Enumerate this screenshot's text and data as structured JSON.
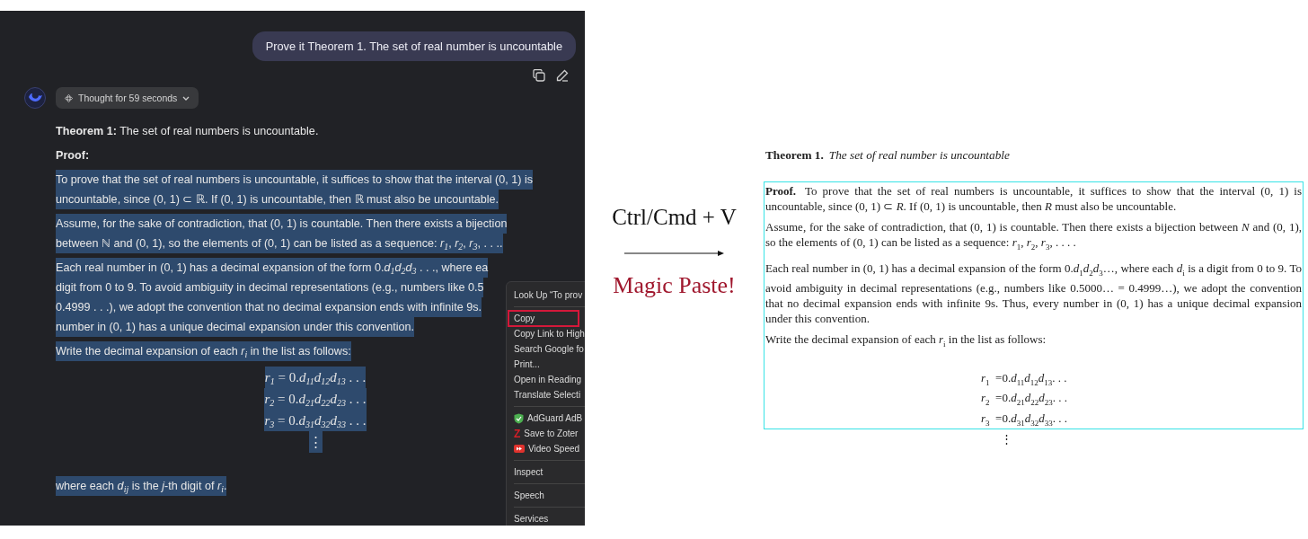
{
  "chat": {
    "user_message": "Prove it Theorem 1. The set of real number is uncountable",
    "thought_button": "Thought for 59 seconds",
    "answer": [
      {
        "kind": "paragraph",
        "selected": false,
        "lines": [
          "**Theorem 1:** The set of real numbers is uncountable."
        ]
      },
      {
        "kind": "heading",
        "selected": false,
        "lines": [
          "Proof:"
        ]
      },
      {
        "kind": "paragraph",
        "selected": true,
        "lines": [
          "To prove that the set of real numbers is uncountable, it suffices to show that the interval (0, 1) is",
          "uncountable, since (0, 1) ⊂ ℝ. If (0, 1) is uncountable, then ℝ must also be uncountable."
        ]
      },
      {
        "kind": "paragraph",
        "selected": true,
        "lines": [
          "Assume, for the sake of contradiction, that (0, 1) is countable. Then there exists a bijection",
          "between ℕ and (0, 1), so the elements of (0, 1) can be listed as a sequence: *r*$_{1}$, *r*$_{2}$, *r*$_{3}$, . . .."
        ]
      },
      {
        "kind": "paragraph",
        "selected": true,
        "lines": [
          "Each real number in (0, 1) has a decimal expansion of the form 0.*d*$_{1}$*d*$_{2}$*d*$_{3}$ . . ., where ea",
          "digit from 0 to 9. To avoid ambiguity in decimal representations (e.g., numbers like 0.5",
          "0.4999 . . .), we adopt the convention that no decimal expansion ends with infinite 9s.",
          "number in (0, 1) has a unique decimal expansion under this convention."
        ]
      },
      {
        "kind": "paragraph",
        "selected": true,
        "lines": [
          "Write the decimal expansion of each *r*$_{i}$ in the list as follows:"
        ]
      },
      {
        "kind": "equations",
        "selected": true,
        "lines": [
          "*r*$_{1}$ = 0.*d*$_{11}$*d*$_{12}$*d*$_{13}$ . . .",
          "*r*$_{2}$ = 0.*d*$_{21}$*d*$_{22}$*d*$_{23}$ . . .",
          "*r*$_{3}$ = 0.*d*$_{31}$*d*$_{32}$*d*$_{33}$ . . .",
          "⋮"
        ]
      },
      {
        "kind": "paragraph",
        "selected": true,
        "lines": [
          "where each *d*$_{ij}$ is the *j*-th digit of *r*$_{i}$."
        ]
      }
    ],
    "context_menu": [
      {
        "kind": "item",
        "label": "Look Up “To prov",
        "selected": false
      },
      {
        "kind": "separator"
      },
      {
        "kind": "item",
        "label": "Copy",
        "selected": true
      },
      {
        "kind": "item",
        "label": "Copy Link to High",
        "selected": false
      },
      {
        "kind": "item",
        "label": "Search Google fo",
        "selected": false
      },
      {
        "kind": "item",
        "label": "Print...",
        "selected": false
      },
      {
        "kind": "item",
        "label": "Open in Reading",
        "selected": false
      },
      {
        "kind": "item",
        "label": "Translate Selecti",
        "selected": false
      },
      {
        "kind": "separator"
      },
      {
        "kind": "shield",
        "label": "AdGuard AdB",
        "selected": false
      },
      {
        "kind": "letter",
        "icon": "Z",
        "label": "Save to Zoter",
        "selected": false
      },
      {
        "kind": "video",
        "label": "Video Speed",
        "selected": false
      },
      {
        "kind": "separator"
      },
      {
        "kind": "item",
        "label": "Inspect",
        "selected": false
      },
      {
        "kind": "separator"
      },
      {
        "kind": "item",
        "label": "Speech",
        "selected": false
      },
      {
        "kind": "separator"
      },
      {
        "kind": "item",
        "label": "Services",
        "selected": false
      }
    ]
  },
  "shortcut": "Ctrl/Cmd + V",
  "caption": "Magic Paste!",
  "document": {
    "theorem_label": "Theorem 1.",
    "theorem_statement": "The set of real number is uncountable",
    "paragraphs": [
      "**Proof.** To prove that the set of real numbers is uncountable, it suffices to show that the interval (0, 1) is uncountable, since (0, 1) ⊂ *R*. If (0, 1) is uncountable, then *R* must also be uncountable.",
      "Assume, for the sake of contradiction, that (0, 1) is countable. Then there exists a bijection between *N* and (0, 1), so the elements of (0, 1) can be listed as a sequence: *r*$_{1}$, *r*$_{2}$, *r*$_{3}$, . . . .",
      "Each real number in (0, 1) has a decimal expansion of the form 0.*d*$_{1}$*d*$_{2}$*d*$_{3}$…, where each *d*$_{i}$ is a digit from 0 to 9. To avoid ambiguity in decimal representations (e.g., numbers like 0.5000… = 0.4999…), we adopt the convention that no decimal expansion ends with infinite 9s. Thus, every number in (0, 1) has a unique decimal expansion under this convention.",
      "Write the decimal expansion of each *r*$_{i}$ in the list as follows:"
    ],
    "equations": [
      "*r*$_{1}$  =0.*d*$_{11}$*d*$_{12}$*d*$_{13}$. . .",
      "*r*$_{2}$  =0.*d*$_{21}$*d*$_{22}$*d*$_{23}$. . .",
      "*r*$_{3}$  =0.*d*$_{31}$*d*$_{32}$*d*$_{33}$. . .",
      "⋮"
    ]
  }
}
